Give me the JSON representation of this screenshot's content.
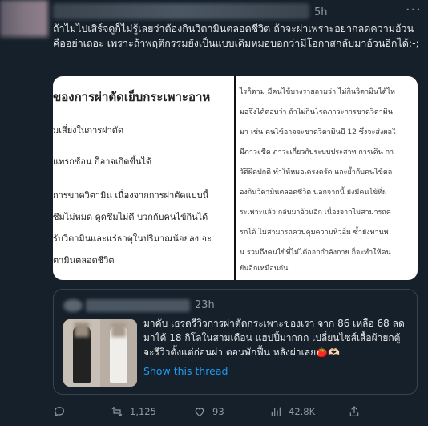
{
  "tweet": {
    "time": "5h",
    "text": "ถ้าไม่ไปเสิร์จดูก็ไม่รู้เลยว่าต้องกินวิตามินตลอดชีวิต ถ้าจะผ่าเพราะอยากลดความอ้วนคืออย่าเถอะ เพราะถ้าพฤติกรรมยังเป็นแบบเดิมหมอบอกว่ามีโอกาสกลับมาอ้วนอีกได้;-;"
  },
  "image_left": {
    "title": "ของการผ่าตัดเย็บกระเพาะอาห",
    "lines": [
      "มเสี่ยงในการผ่าตัด",
      "แทรกซ้อน ก็อาจเกิดขึ้นได้",
      "การขาดวิตามิน เนื่องจากการผ่าตัดแบบนี้",
      "ซึมไม่หมด ดูดซึมไม่ดี บวกกับคนไข้กินได้",
      "รับวิตามินและแร่ธาตุในปริมาณน้อยลง จะ",
      "ตามินตลอดชีวิต"
    ]
  },
  "image_right": {
    "lines": [
      "ไรก็ตาม มีคนไข้บางรายถามว่า ไม่กินวิตามินได้ไห",
      "มอจึงได้ตอบว่า ถ้าไม่กินโรคภาวะการขาดวิตามิน",
      "มา เช่น คนไข้อาจจะขาดวิตามินบี 12 ซึ่งจะส่งผลใ",
      "มีภาวะซีด ภาวะเกี่ยวกับระบบประสาท การเดิน กา",
      "วัติผิดปกติ ทำให้หมอเครงครัด และย้ำกับคนไข้ตล",
      "องกินวิตามินตลอดชีวิต นอกจากนี้ ยังมีคนไข้ที่ผ่",
      "ระเพาะแล้ว กลับมาอ้วนอีก เนื่องจากไม่สามารถค",
      "รกได้ ไม่สามารถควบคุมความหิวอิ่ม ซ้ำยังทานพ",
      "น รวมถึงคนไข้ที่ไม่ได้ออกกำลังกาย ก็จะทำให้คน",
      "ยันอีกเหมือนกัน"
    ]
  },
  "quote": {
    "time": "23h",
    "text": "มาคับ เธรดรีวิวการผ่าตัดกระเพาะของเรา จาก 86 เหลือ 68 ลดมาได้ 18 กิโลในสามเดือน แฮปปี้มากกก เปลี่ยนไซส์เสื้อผ้ายกตู้ จะรีวิวตั้งแต่ก่อนผ่า ตอนพักฟื้น หลังผ่าเลย🍅🫶🏻",
    "link": "Show this thread"
  },
  "actions": {
    "reply_count": "",
    "retweet_count": "1,125",
    "like_count": "93",
    "views_count": "42.8K"
  },
  "icons": {
    "more": "more-dots-icon",
    "reply": "reply-icon",
    "retweet": "retweet-icon",
    "like": "heart-icon",
    "views": "views-bar-icon",
    "share": "share-icon"
  },
  "colors": {
    "background": "#15202b",
    "accent": "#1d9bf0",
    "muted": "#8b98a5",
    "border": "#38444d"
  }
}
